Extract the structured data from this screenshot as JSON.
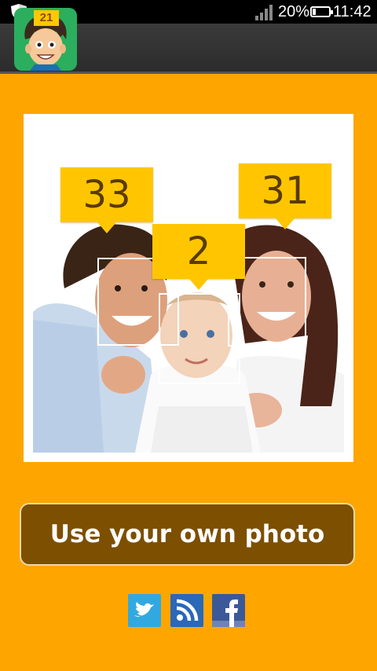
{
  "status_bar": {
    "battery_percent": "20%",
    "battery_level": 0.2,
    "time": "11:42",
    "icons": [
      "shield-icon",
      "signal-icon",
      "battery-icon"
    ]
  },
  "app": {
    "icon_badge": "21",
    "icon_name": "age-guess-app-icon"
  },
  "sample_photo": {
    "ages": [
      "33",
      "2",
      "31"
    ]
  },
  "actions": {
    "own_photo_label": "Use your own photo"
  },
  "share": {
    "icons": [
      "twitter-icon",
      "rss-icon",
      "facebook-icon"
    ]
  },
  "colors": {
    "background": "#FFA500",
    "bubble": "#FFC600",
    "button": "#7D4F00",
    "status_bar": "#000000",
    "action_bar": "#333333",
    "twitter": "#31A9E0",
    "rss": "#2A68B8",
    "facebook": "#3B5998"
  }
}
